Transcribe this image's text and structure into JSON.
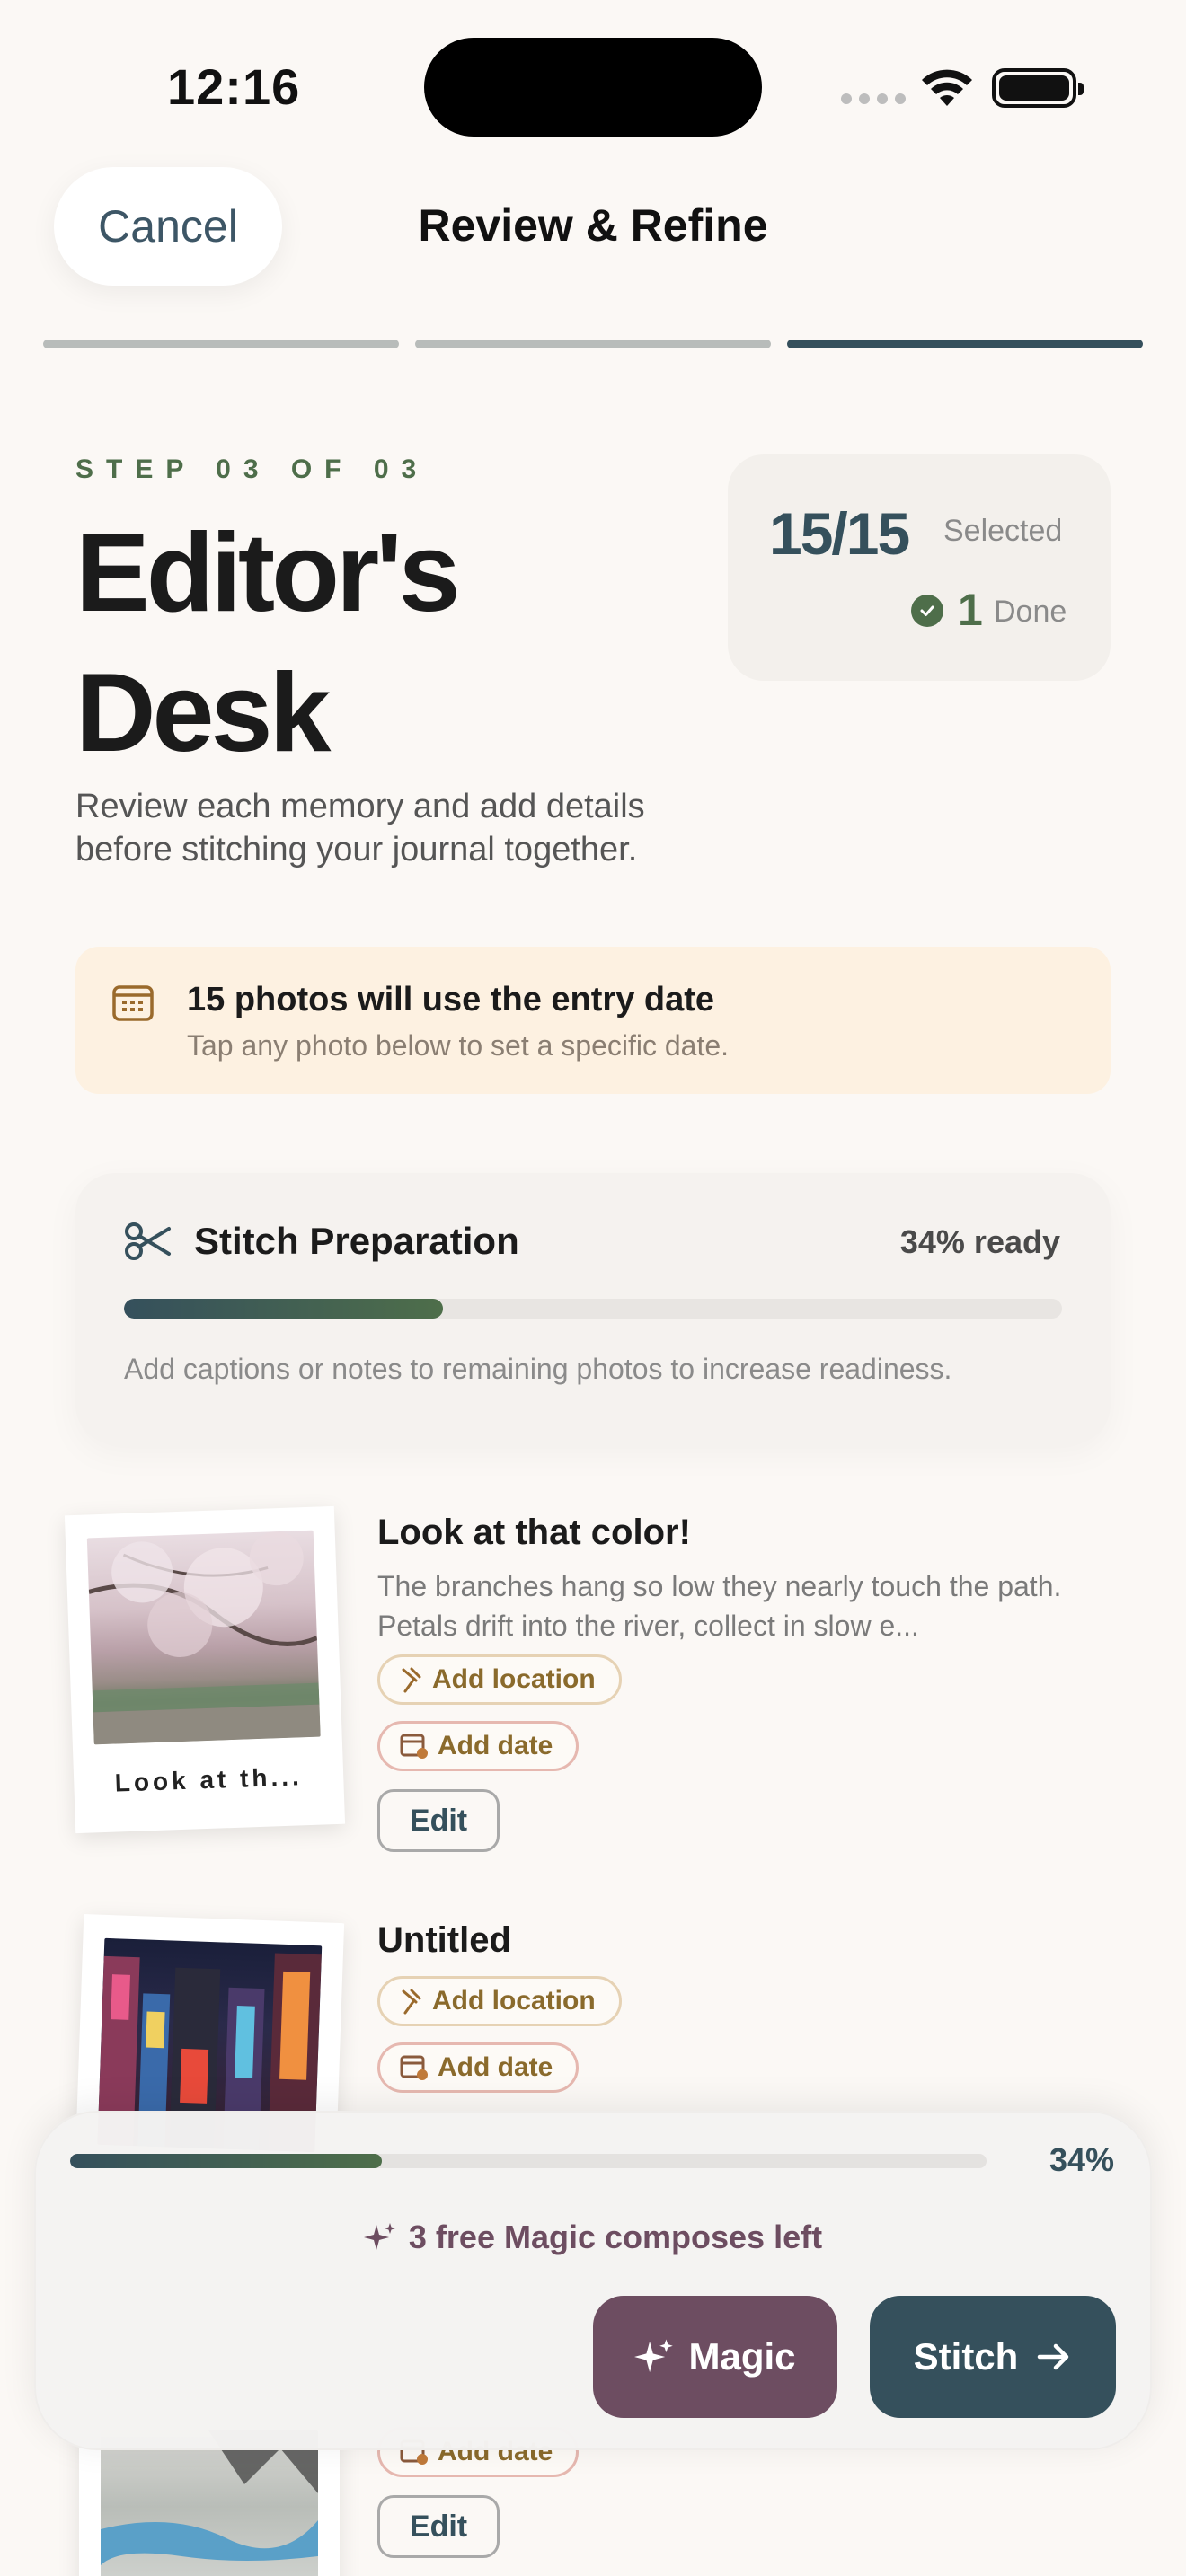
{
  "status_bar": {
    "time": "12:16"
  },
  "header": {
    "cancel_label": "Cancel",
    "title": "Review & Refine",
    "steps_total": 3,
    "step_current": 3
  },
  "hero": {
    "eyebrow": "STEP 03 OF 03",
    "title": "Editor's Desk",
    "subtitle": "Review each memory and add details before stitching your journal together."
  },
  "stats": {
    "selected_count": "15/15",
    "selected_label": "Selected",
    "done_count": "1",
    "done_label": "Done"
  },
  "date_banner": {
    "title": "15 photos will use the entry date",
    "subtitle": "Tap any photo below to set a specific date."
  },
  "stitch_prep": {
    "title": "Stitch Preparation",
    "ready_text": "34% ready",
    "progress": 0.34,
    "note": "Add captions or notes to remaining photos to increase readiness."
  },
  "memories": [
    {
      "caption": "Look at th...",
      "title": "Look at that color!",
      "body": "The branches hang so low they nearly touch the path. Petals drift into the river, collect in slow e...",
      "location_label": "Add location",
      "date_label": "Add date",
      "edit_label": "Edit"
    },
    {
      "title": "Untitled",
      "location_label": "Add location",
      "date_label": "Add date"
    },
    {
      "date_label": "Add date",
      "edit_label": "Edit"
    }
  ],
  "dock": {
    "progress_pct": "34%",
    "progress": 0.34,
    "magic_note": "3 free Magic composes left",
    "magic_label": "Magic",
    "stitch_label": "Stitch"
  },
  "colors": {
    "primary": "#35505c",
    "accent_green": "#4e6e4a",
    "magic": "#6d4d61",
    "banner_bg": "#fdf1e1"
  }
}
